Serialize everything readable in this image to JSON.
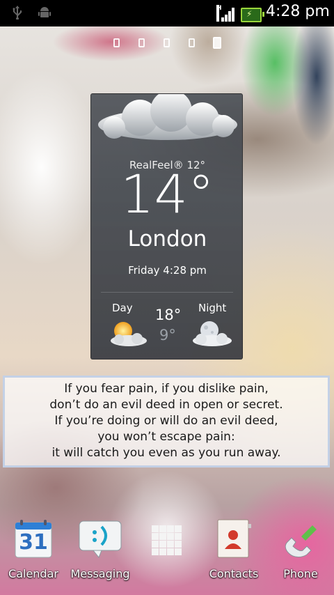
{
  "status_bar": {
    "time": "4:28 pm",
    "icons": [
      "usb-icon",
      "android-debug-icon",
      "signal-h-icon",
      "battery-charging-icon"
    ]
  },
  "pager": {
    "pages": 5,
    "active_index": 4
  },
  "weather_widget": {
    "realfeel": "RealFeel® 12°",
    "temperature": "14°",
    "city": "London",
    "day_time": "Friday 4:28 pm",
    "day_label": "Day",
    "night_label": "Night",
    "high": "18°",
    "low": "9°",
    "icons": [
      "cloud-icon",
      "sun-cloud-icon",
      "moon-cloud-icon"
    ]
  },
  "quote": {
    "lines": [
      "If you fear pain, if you dislike pain,",
      "don’t do an evil deed in open or secret.",
      "If you’re doing or will do an evil deed,",
      "you won’t escape pain:",
      "it will catch you even as you run away."
    ]
  },
  "dock": {
    "calendar": {
      "label": "Calendar",
      "date": "31"
    },
    "messaging": {
      "label": "Messaging"
    },
    "apps": {
      "icon": "app-grid-icon"
    },
    "contacts": {
      "label": "Contacts"
    },
    "phone": {
      "label": "Phone"
    }
  }
}
